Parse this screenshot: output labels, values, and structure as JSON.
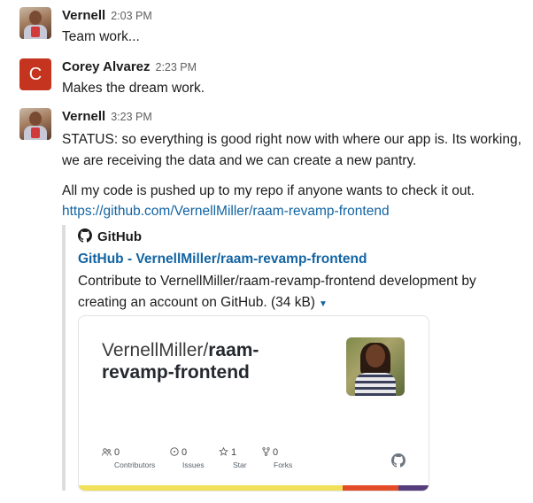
{
  "messages": [
    {
      "author": "Vernell",
      "time": "2:03 PM",
      "avatar": "photo-avatar",
      "lines": [
        "Team work..."
      ]
    },
    {
      "author": "Corey Alvarez",
      "time": "2:23 PM",
      "avatar_letter": "C",
      "avatar_color": "#c4341f",
      "lines": [
        "Makes the dream work."
      ]
    },
    {
      "author": "Vernell",
      "time": "3:23 PM",
      "avatar": "photo-avatar",
      "status_text": "STATUS: so everything is good right now with where our app is. Its working, we are receiving the data and we can create a new pantry.",
      "push_text": "All my code is pushed up to my repo if anyone wants to check it out.",
      "link": "https://github.com/VernellMiller/raam-revamp-frontend"
    }
  ],
  "attachment": {
    "service": "GitHub",
    "service_icon": "github-icon",
    "title": "GitHub - VernellMiller/raam-revamp-frontend",
    "description": "Contribute to VernellMiller/raam-revamp-frontend development by creating an account on GitHub.",
    "size": "(34 kB)",
    "card": {
      "owner": "VernellMiller/",
      "repo": "raam-revamp-frontend",
      "stats": [
        {
          "icon": "contributors-icon",
          "count": "0",
          "label": "Contributors"
        },
        {
          "icon": "issues-icon",
          "count": "0",
          "label": "Issues"
        },
        {
          "icon": "star-icon",
          "count": "1",
          "label": "Star"
        },
        {
          "icon": "forks-icon",
          "count": "0",
          "label": "Forks"
        }
      ],
      "language_bar": [
        {
          "color": "#f1e05a",
          "fraction": 0.755
        },
        {
          "color": "#e34c26",
          "fraction": 0.16
        },
        {
          "color": "#563d7c",
          "fraction": 0.085
        }
      ]
    }
  }
}
